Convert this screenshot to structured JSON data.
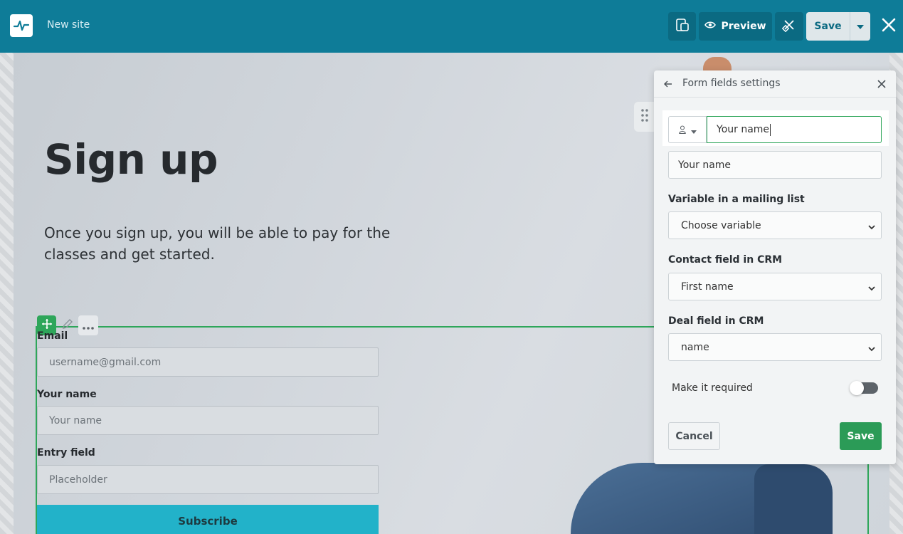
{
  "topbar": {
    "site_name": "New site",
    "preview_label": "Preview",
    "save_label": "Save"
  },
  "hero": {
    "title": "Sign up",
    "text": "Once you sign up, you will be able to pay for the classes and get started."
  },
  "form": {
    "fields": [
      {
        "label": "Email",
        "placeholder": "username@gmail.com"
      },
      {
        "label": "Your name",
        "placeholder": "Your name"
      },
      {
        "label": "Entry field",
        "placeholder": "Placeholder"
      }
    ],
    "subscribe_label": "Subscribe"
  },
  "panel": {
    "title": "Form fields settings",
    "label_value": "Your name",
    "placeholder_value": "Your name",
    "mailing_list_label": "Variable in a mailing list",
    "mailing_list_value": "Choose variable",
    "crm_contact_label": "Contact field in CRM",
    "crm_contact_value": "First name",
    "crm_deal_label": "Deal field in CRM",
    "crm_deal_value": "name",
    "required_label": "Make it required",
    "required_on": false,
    "cancel_label": "Cancel",
    "save_label": "Save"
  },
  "colors": {
    "topbar": "#0e7c98",
    "accent_green": "#2b9b57",
    "subscribe": "#22b2c9"
  }
}
